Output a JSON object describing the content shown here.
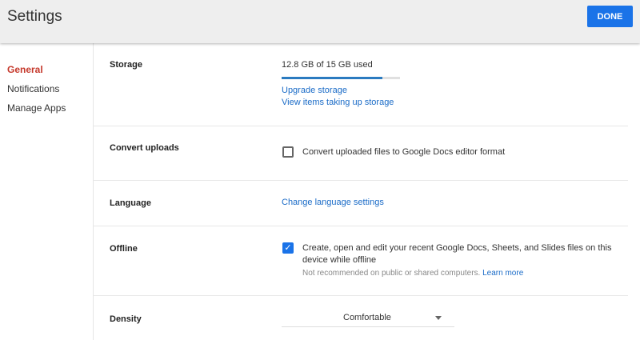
{
  "header": {
    "title": "Settings",
    "done_label": "DONE"
  },
  "sidebar": {
    "items": [
      {
        "label": "General",
        "active": true
      },
      {
        "label": "Notifications"
      },
      {
        "label": "Manage Apps"
      }
    ]
  },
  "storage": {
    "label": "Storage",
    "usage_text": "12.8 GB of 15 GB used",
    "used_percent": 85,
    "upgrade_link": "Upgrade storage",
    "view_link": "View items taking up storage"
  },
  "convert": {
    "label": "Convert uploads",
    "checkbox_label": "Convert uploaded files to Google Docs editor format",
    "checked": false
  },
  "language": {
    "label": "Language",
    "link": "Change language settings"
  },
  "offline": {
    "label": "Offline",
    "checkbox_label_1": "Create, open and edit your recent Google Docs, Sheets, and Slides files on this",
    "checkbox_label_2": "device while offline",
    "note": "Not recommended on public or shared computers.",
    "learn_more": "Learn more",
    "checked": true
  },
  "density": {
    "label": "Density",
    "value": "Comfortable"
  },
  "colors": {
    "accent": "#1a73e8",
    "active_nav": "#c5382b",
    "link": "#1a6bc7"
  }
}
